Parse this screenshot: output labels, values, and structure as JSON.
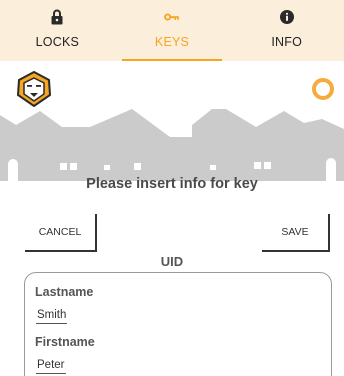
{
  "tabs": [
    {
      "label": "LOCKS",
      "icon": "lock-icon",
      "active": false
    },
    {
      "label": "KEYS",
      "icon": "key-icon",
      "active": true
    },
    {
      "label": "INFO",
      "icon": "info-icon",
      "active": false
    }
  ],
  "colors": {
    "accent": "#f5a623",
    "tabbar_bg": "#fbeedb",
    "skyline": "#cbcbcb"
  },
  "header": {
    "logo_icon": "lion-logo-icon",
    "status_icon": "status-ring-icon"
  },
  "form": {
    "prompt": "Please insert info for key",
    "cancel_label": "CANCEL",
    "save_label": "SAVE",
    "uid_label": "UID",
    "fields": [
      {
        "label": "Lastname",
        "value": "Smith"
      },
      {
        "label": "Firstname",
        "value": "Peter"
      }
    ]
  }
}
